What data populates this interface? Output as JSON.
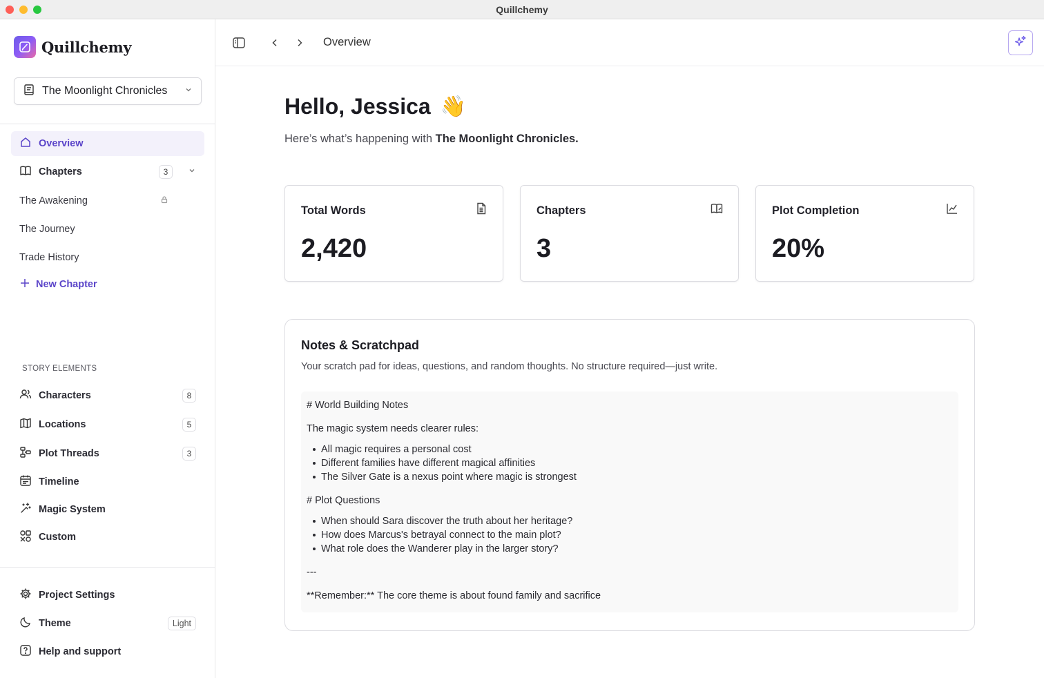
{
  "window": {
    "title": "Quillchemy"
  },
  "brand": {
    "name": "Quillchemy"
  },
  "project": {
    "name": "The Moonlight Chronicles"
  },
  "nav": {
    "overview": "Overview",
    "chapters": {
      "label": "Chapters",
      "count": "3"
    },
    "chapter_items": [
      "The Awakening",
      "The Journey",
      "Trade History"
    ],
    "new_chapter": "New Chapter"
  },
  "story_elements": {
    "label": "STORY ELEMENTS",
    "items": [
      {
        "label": "Characters",
        "count": "8",
        "icon": "users-icon"
      },
      {
        "label": "Locations",
        "count": "5",
        "icon": "map-icon"
      },
      {
        "label": "Plot Threads",
        "count": "3",
        "icon": "workflow-icon"
      },
      {
        "label": "Timeline",
        "count": "",
        "icon": "calendar-icon"
      },
      {
        "label": "Magic System",
        "count": "",
        "icon": "wand-icon"
      },
      {
        "label": "Custom",
        "count": "",
        "icon": "shapes-icon"
      }
    ]
  },
  "footer_nav": {
    "settings": "Project Settings",
    "theme": "Theme",
    "theme_value": "Light",
    "help": "Help and support"
  },
  "topbar": {
    "breadcrumb": "Overview"
  },
  "greeting": {
    "title": "Hello, Jessica",
    "emoji": "👋",
    "subtitle_prefix": "Here’s what’s happening with ",
    "subtitle_project": "The Moonlight Chronicles."
  },
  "stats": [
    {
      "label": "Total Words",
      "value": "2,420",
      "icon": "file-text-icon"
    },
    {
      "label": "Chapters",
      "value": "3",
      "icon": "book-open-icon"
    },
    {
      "label": "Plot Completion",
      "value": "20%",
      "icon": "chart-line-icon"
    }
  ],
  "notes": {
    "title": "Notes & Scratchpad",
    "description": "Your scratch pad for ideas, questions, and random thoughts. No structure required—just write.",
    "heading1": "# World Building Notes",
    "para1": "The magic system needs clearer rules:",
    "list1": [
      "All magic requires a personal cost",
      "Different families have different magical affinities",
      "The Silver Gate is a nexus point where magic is strongest"
    ],
    "heading2": "# Plot Questions",
    "list2": [
      "When should Sara discover the truth about her heritage?",
      "How does Marcus's betrayal connect to the main plot?",
      "What role does the Wanderer play in the larger story?"
    ],
    "rule": "---",
    "closing": "**Remember:** The core theme is about found family and sacrifice"
  },
  "colors": {
    "accent": "#5b45c9",
    "active_bg": "#f3f1fb"
  }
}
